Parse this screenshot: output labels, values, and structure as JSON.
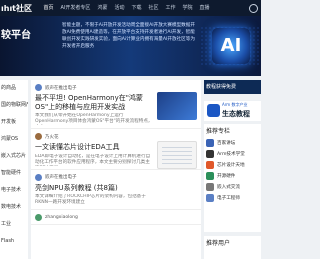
{
  "topbar": {
    "logo": "ıhıt社区",
    "nav": [
      "首页",
      "AI开发者专区",
      "鸿蒙",
      "活动",
      "下载",
      "社区",
      "工作",
      "学院",
      "直播"
    ]
  },
  "banner": {
    "title": "较平台",
    "text": "智能主题，不限于Ai开放开发活动周全面接AI开放大赛模型数据开放AI免费使用Ai建造等，在开放平台支持开发者进行AI开发，智能联创开发实践研发实验，面向Ai计算业内拥有海量AI开放社区等为开发者开启服务"
  },
  "sidebar": {
    "items": [
      "的商品",
      "国的物联网产品",
      "开发板",
      "鸿蒙OS",
      "嵌入式芯片",
      "智能硬件",
      "电子技术",
      "数电技术",
      "工业",
      "Flash"
    ]
  },
  "feed": {
    "posts": [
      {
        "author": "嵌声在推出电子",
        "title": "最不平坦! OpenHarmony在\"鸿蒙OS\"上的移植与应用开发实战",
        "excerpt": "本文我们从零开始在OpenHarmony上运行OpenHarmony项目体会鸿蒙OS\"平台\"的开发流程特点，本文..."
      },
      {
        "author": "乃火花",
        "title": "一文读懂芯片设计EDA工具",
        "excerpt": "EDA即电子设计自动化，是在电子设计上用计算机进行自动化工作平台的软件应用程序，本文主要分别探讨几类主流EDA工具"
      },
      {
        "author": "嵌声在推出电子",
        "title": "亮剑NPU系列教程 (共8篇)",
        "excerpt": "本文详细介绍了ROCKCHIP芯片的架构内容，包括基于RKNN一路开发环境建立"
      },
      {
        "author": "zhangxiaolong"
      }
    ]
  },
  "right": {
    "promo": "教程获得免费",
    "promo2_small": "Arm 数字产业",
    "promo2_big": "生态教程",
    "recommend_title": "推荐专栏",
    "recommend": [
      {
        "name": "百家讲坛",
        "sub": ""
      },
      {
        "name": "Arm技术学堂",
        "sub": ""
      },
      {
        "name": "芯片设计天地",
        "sub": ""
      },
      {
        "name": "开源硬件",
        "sub": ""
      },
      {
        "name": "嵌入式交流",
        "sub": ""
      },
      {
        "name": "电子工程师",
        "sub": ""
      }
    ],
    "users_title": "推荐用户"
  }
}
